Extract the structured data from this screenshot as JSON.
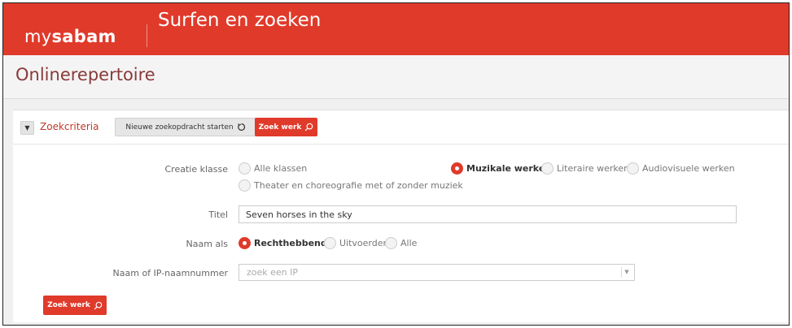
{
  "header": {
    "logo_my": "my",
    "logo_sabam": "sabam",
    "app_title": "Surfen en zoeken"
  },
  "page": {
    "title": "Onlinerepertoire"
  },
  "panel": {
    "criteria_label": "Zoekcriteria",
    "new_search_label": "Nieuwe zoekopdracht starten",
    "search_label": "Zoek werk"
  },
  "form": {
    "creatie_klasse": {
      "label": "Creatie klasse",
      "options": [
        {
          "label": "Alle klassen",
          "selected": false
        },
        {
          "label": "Muzikale werken",
          "selected": true
        },
        {
          "label": "Literaire werken",
          "selected": false
        },
        {
          "label": "Audiovisuele werken",
          "selected": false
        },
        {
          "label": "Theater en choreografie met of zonder muziek",
          "selected": false
        }
      ]
    },
    "titel": {
      "label": "Titel",
      "value": "Seven horses in the sky"
    },
    "naam_als": {
      "label": "Naam als",
      "options": [
        {
          "label": "Rechthebbende",
          "selected": true
        },
        {
          "label": "Uitvoerder",
          "selected": false
        },
        {
          "label": "Alle",
          "selected": false
        }
      ]
    },
    "ip": {
      "label": "Naam of IP-naamnummer",
      "placeholder": "zoek een IP"
    },
    "submit_label": "Zoek werk"
  },
  "icons": {
    "collapse": "caret-down-icon",
    "refresh": "refresh-icon",
    "search": "search-icon",
    "dropdown": "dropdown-arrow-icon"
  },
  "colors": {
    "brand_red": "#e03a2b",
    "page_title": "#8a3a3a"
  }
}
